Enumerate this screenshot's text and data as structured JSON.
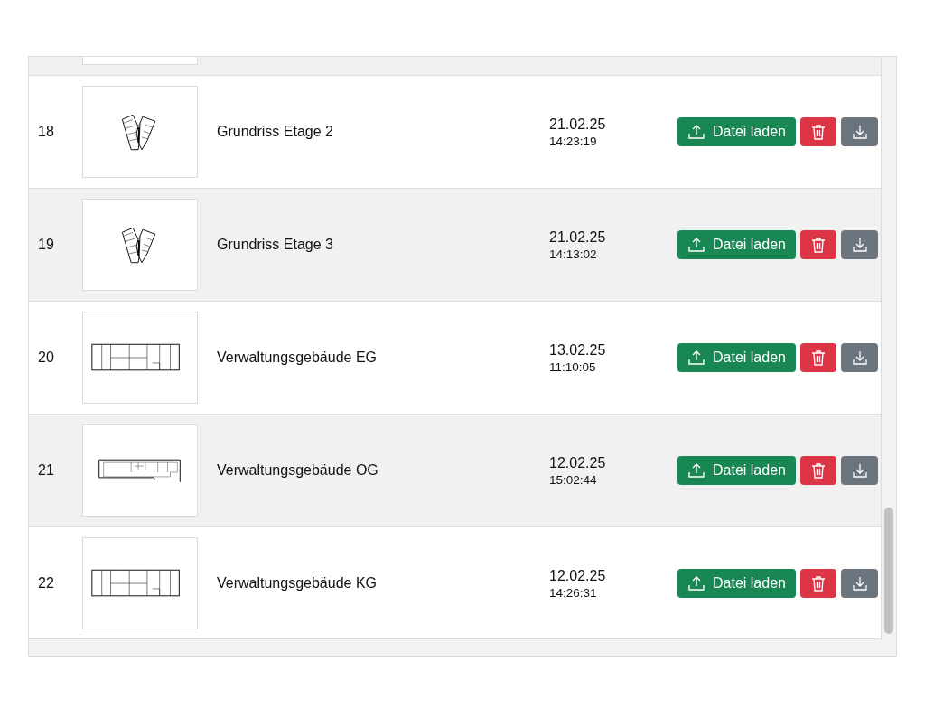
{
  "rows": [
    {
      "number": "18",
      "kind": "vwing",
      "name": "Grundriss Etage 2",
      "date": "21.02.25",
      "time": "14:23:19",
      "upload_label": "Datei laden"
    },
    {
      "number": "19",
      "kind": "vwing",
      "name": "Grundriss Etage 3",
      "date": "21.02.25",
      "time": "14:13:02",
      "upload_label": "Datei laden"
    },
    {
      "number": "20",
      "kind": "block",
      "name": "Verwaltungsgebäude EG",
      "date": "13.02.25",
      "time": "11:10:05",
      "upload_label": "Datei laden"
    },
    {
      "number": "21",
      "kind": "lwing",
      "name": "Verwaltungsgebäude OG",
      "date": "12.02.25",
      "time": "15:02:44",
      "upload_label": "Datei laden"
    },
    {
      "number": "22",
      "kind": "block",
      "name": "Verwaltungsgebäude KG",
      "date": "12.02.25",
      "time": "14:26:31",
      "upload_label": "Datei laden"
    }
  ]
}
